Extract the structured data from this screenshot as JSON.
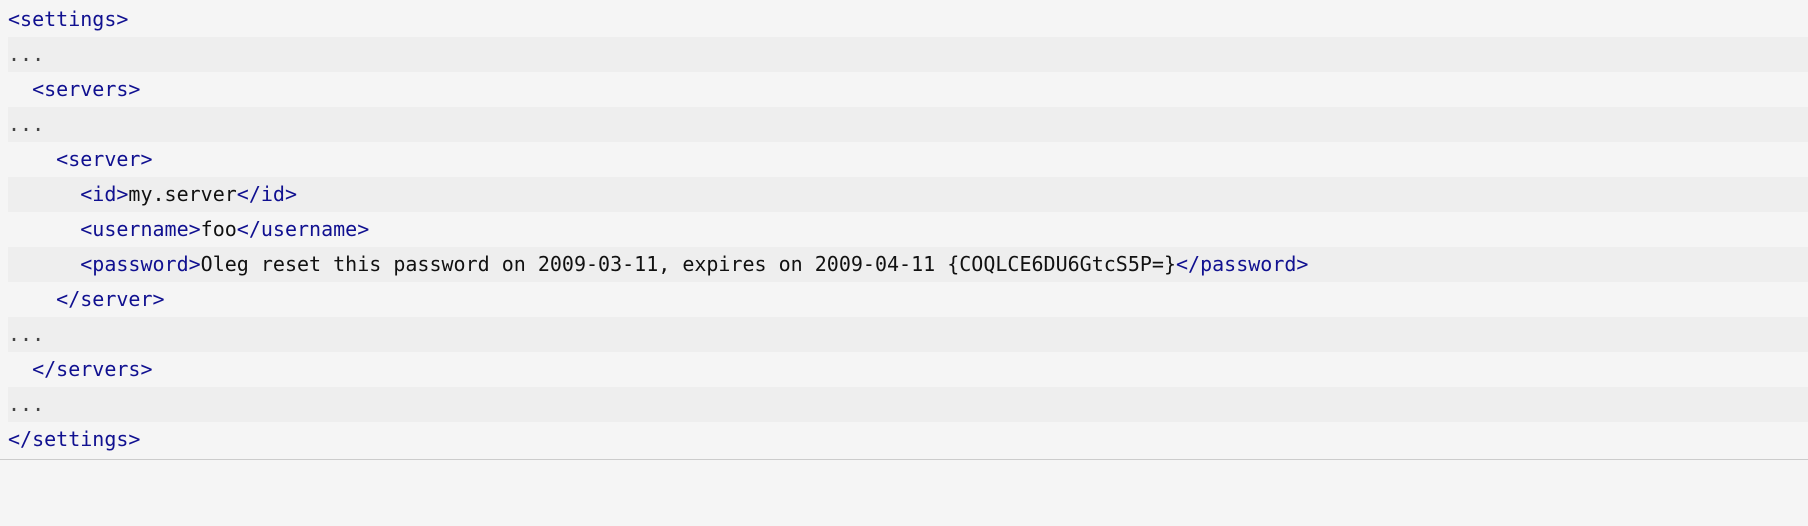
{
  "code": {
    "lines": [
      {
        "indent": "",
        "segments": [
          {
            "cls": "tag",
            "t": "<settings>"
          }
        ]
      },
      {
        "indent": "",
        "segments": [
          {
            "cls": "ellipsis",
            "t": "..."
          }
        ]
      },
      {
        "indent": "  ",
        "segments": [
          {
            "cls": "tag",
            "t": "<servers>"
          }
        ]
      },
      {
        "indent": "",
        "segments": [
          {
            "cls": "ellipsis",
            "t": "..."
          }
        ]
      },
      {
        "indent": "    ",
        "segments": [
          {
            "cls": "tag",
            "t": "<server>"
          }
        ]
      },
      {
        "indent": "      ",
        "segments": [
          {
            "cls": "tag",
            "t": "<id>"
          },
          {
            "cls": "text",
            "t": "my.server"
          },
          {
            "cls": "tag",
            "t": "</id>"
          }
        ]
      },
      {
        "indent": "      ",
        "segments": [
          {
            "cls": "tag",
            "t": "<username>"
          },
          {
            "cls": "text",
            "t": "foo"
          },
          {
            "cls": "tag",
            "t": "</username>"
          }
        ]
      },
      {
        "indent": "      ",
        "segments": [
          {
            "cls": "tag",
            "t": "<password>"
          },
          {
            "cls": "text",
            "t": "Oleg reset this password on 2009-03-11, expires on 2009-04-11 {COQLCE6DU6GtcS5P=}"
          },
          {
            "cls": "tag",
            "t": "</password>"
          }
        ]
      },
      {
        "indent": "    ",
        "segments": [
          {
            "cls": "tag",
            "t": "</server>"
          }
        ]
      },
      {
        "indent": "",
        "segments": [
          {
            "cls": "ellipsis",
            "t": "..."
          }
        ]
      },
      {
        "indent": "  ",
        "segments": [
          {
            "cls": "tag",
            "t": "</servers>"
          }
        ]
      },
      {
        "indent": "",
        "segments": [
          {
            "cls": "ellipsis",
            "t": "..."
          }
        ]
      },
      {
        "indent": "",
        "segments": [
          {
            "cls": "tag",
            "t": "</settings>"
          }
        ]
      }
    ]
  }
}
